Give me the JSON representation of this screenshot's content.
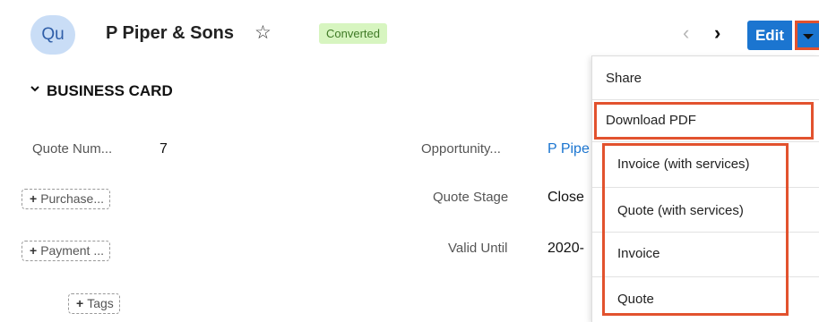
{
  "header": {
    "avatar_text": "Qu",
    "record_name": "P Piper & Sons",
    "status_badge": "Converted",
    "edit_label": "Edit"
  },
  "business_card": {
    "title": "BUSINESS CARD",
    "fields": {
      "quote_number_label": "Quote Num...",
      "quote_number_value": "7",
      "opportunity_label": "Opportunity...",
      "opportunity_value": "P Pipe",
      "quote_stage_label": "Quote Stage",
      "quote_stage_value": "Close",
      "valid_until_label": "Valid Until",
      "valid_until_value": "2020-"
    },
    "add_buttons": {
      "purchase": "Purchase...",
      "payment": "Payment ...",
      "tags": "Tags"
    }
  },
  "actions_menu": {
    "items": [
      "Share",
      "Download PDF",
      "Invoice (with services)",
      "Quote (with services)",
      "Invoice",
      "Quote"
    ]
  },
  "colors": {
    "accent": "#1b75d0",
    "highlight": "#e2522e",
    "badge_bg": "#d7f5c0",
    "avatar_bg": "#c9ddf6"
  },
  "icons": {
    "favorite": "star-outline-icon",
    "previous": "chevron-left-icon",
    "next": "chevron-right-icon",
    "actions": "caret-down-icon",
    "collapse": "chevron-down-icon"
  }
}
